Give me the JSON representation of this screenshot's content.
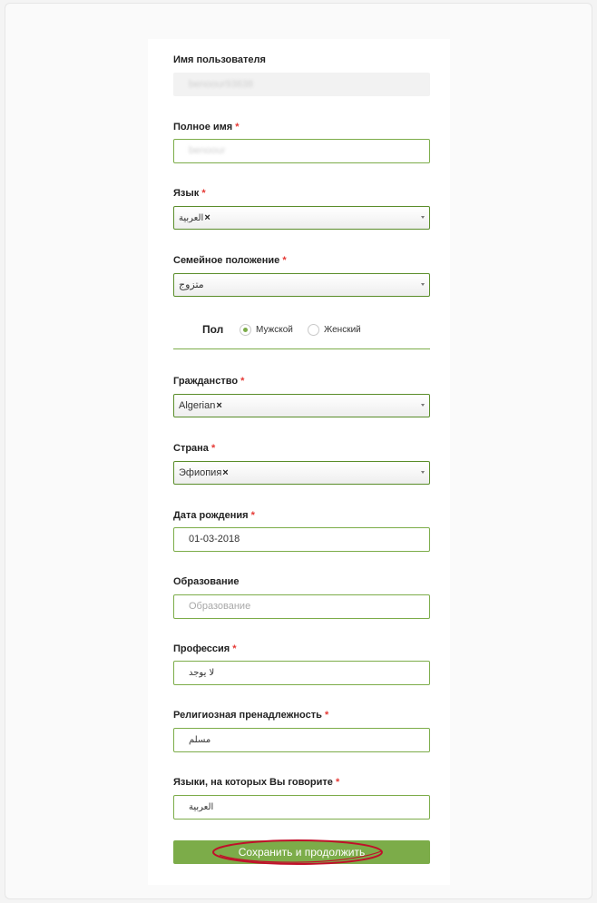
{
  "form": {
    "username": {
      "label": "Имя пользователя",
      "value": "benoour93838"
    },
    "fullname": {
      "label": "Полное имя",
      "required": "*",
      "value": "benoour"
    },
    "language": {
      "label": "Язык",
      "required": "*",
      "chip": "العربية",
      "chip_remove": "×"
    },
    "marital": {
      "label": "Семейное положение",
      "required": "*",
      "value": "متزوج"
    },
    "gender": {
      "label": "Пол",
      "options": [
        {
          "label": "Мужской",
          "checked": true
        },
        {
          "label": "Женский",
          "checked": false
        }
      ]
    },
    "citizenship": {
      "label": "Гражданство",
      "required": "*",
      "chip": "Algerian",
      "chip_remove": "×"
    },
    "country": {
      "label": "Страна",
      "required": "*",
      "chip": "Эфиопия",
      "chip_remove": "×"
    },
    "birthdate": {
      "label": "Дата рождения",
      "required": "*",
      "value": "01-03-2018"
    },
    "education": {
      "label": "Образование",
      "placeholder": "Образование"
    },
    "profession": {
      "label": "Профессия",
      "required": "*",
      "value": "لا يوجد"
    },
    "religion": {
      "label": "Религиозная пренадлежность",
      "required": "*",
      "value": "مسلم"
    },
    "spoken_languages": {
      "label": "Языки, на которых Вы говорите",
      "required": "*",
      "value": "العربية"
    },
    "submit_label": "Сохранить и продолжить"
  },
  "colors": {
    "accent": "#7cac49",
    "required": "#e53935",
    "annotation": "#c0102a"
  }
}
